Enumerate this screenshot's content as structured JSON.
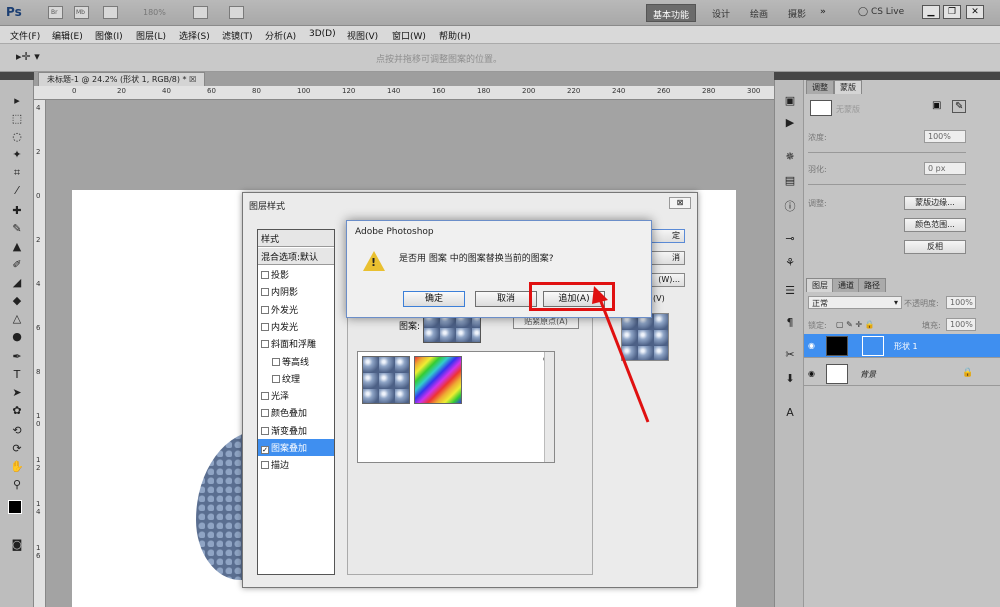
{
  "titlebar": {
    "app_logo": "Ps",
    "br_label": "Br",
    "mb_label": "Mb",
    "zoom": "180%",
    "workspaces": [
      "基本功能",
      "设计",
      "绘画",
      "摄影"
    ],
    "more": "»",
    "cs_live": "CS Live"
  },
  "menu": [
    "文件(F)",
    "编辑(E)",
    "图像(I)",
    "图层(L)",
    "选择(S)",
    "滤镜(T)",
    "分析(A)",
    "3D(D)",
    "视图(V)",
    "窗口(W)",
    "帮助(H)"
  ],
  "options_bar": {
    "hint": "点按并拖移可调整图案的位置。"
  },
  "document": {
    "tab_title": "未标题-1 @ 24.2% (形状 1, RGB/8) *",
    "ruler_top": [
      "0",
      "20",
      "40",
      "60",
      "80",
      "100",
      "120",
      "140",
      "160",
      "180",
      "200",
      "220",
      "240",
      "260",
      "280",
      "300"
    ],
    "ruler_left": [
      "4",
      "2",
      "0",
      "2",
      "4",
      "6",
      "8",
      "1",
      "0",
      "1",
      "2",
      "1",
      "4",
      "1",
      "6"
    ]
  },
  "adjust_panel": {
    "tabs": [
      "调整",
      "蒙版"
    ],
    "mask_label": "无蒙版",
    "density_label": "浓度:",
    "density_value": "100%",
    "feather_label": "羽化:",
    "feather_value": "0 px",
    "refine_label": "调整:",
    "btn_edge": "蒙版边缘...",
    "btn_color": "颜色范围...",
    "btn_invert": "反相"
  },
  "layers_panel": {
    "tabs": [
      "图层",
      "通道",
      "路径"
    ],
    "blend_mode": "正常",
    "opacity_label": "不透明度:",
    "opacity_value": "100%",
    "lock_label": "锁定:",
    "fill_label": "填充:",
    "fill_value": "100%",
    "layers": [
      {
        "name": "形状 1",
        "selected": true
      },
      {
        "name": "背景",
        "selected": false
      }
    ]
  },
  "layer_style": {
    "title": "图层样式",
    "close": "⊠",
    "style_header": "样式",
    "blend_default": "混合选项:默认",
    "items": [
      {
        "label": "投影",
        "checked": false,
        "indent": false
      },
      {
        "label": "内阴影",
        "checked": false,
        "indent": false
      },
      {
        "label": "外发光",
        "checked": false,
        "indent": false
      },
      {
        "label": "内发光",
        "checked": false,
        "indent": false
      },
      {
        "label": "斜面和浮雕",
        "checked": false,
        "indent": false
      },
      {
        "label": "等高线",
        "checked": false,
        "indent": true
      },
      {
        "label": "纹理",
        "checked": false,
        "indent": true
      },
      {
        "label": "光泽",
        "checked": false,
        "indent": false
      },
      {
        "label": "颜色叠加",
        "checked": false,
        "indent": false
      },
      {
        "label": "渐变叠加",
        "checked": false,
        "indent": false
      },
      {
        "label": "图案叠加",
        "checked": true,
        "indent": false
      },
      {
        "label": "描边",
        "checked": false,
        "indent": false
      }
    ],
    "pattern_label": "图案:",
    "snap_btn": "贴紧原点(A)",
    "right_btn1": "定",
    "right_btn2": "消",
    "right_btn3": "(W)...",
    "right_btn4": "(V)"
  },
  "confirm": {
    "title": "Adobe Photoshop",
    "message": "是否用 图案 中的图案替换当前的图案?",
    "ok": "确定",
    "cancel": "取消",
    "append": "追加(A)"
  },
  "colors": {
    "highlight": "#e01010",
    "selection": "#3f8ff0",
    "warning": "#e9c030"
  }
}
